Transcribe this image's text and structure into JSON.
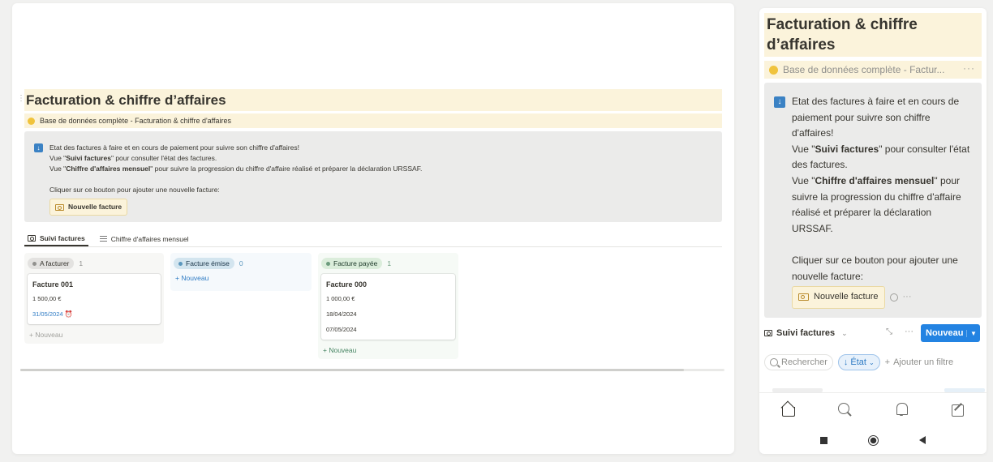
{
  "desktop": {
    "title": "Facturation & chiffre d’affaires",
    "db_link": "Base de données complète - Facturation & chiffre d'affaires",
    "callout": {
      "line1": "Etat des factures à faire et en cours de paiement pour suivre son chiffre d'affaires!",
      "line2_prefix": "Vue \"",
      "line2_bold": "Suivi factures",
      "line2_suffix": "\" pour consulter l'état des factures.",
      "line3_prefix": "Vue \"",
      "line3_bold": "Chiffre d'affaires mensuel",
      "line3_suffix": "\" pour suivre la progression du chiffre d'affaire réalisé et préparer la déclaration URSSAF.",
      "line4": "Cliquer sur ce bouton pour ajouter une nouvelle facture:",
      "button": "Nouvelle facture"
    },
    "tabs": [
      {
        "label": "Suivi factures",
        "icon": "board-icon"
      },
      {
        "label": "Chiffre d'affaires mensuel",
        "icon": "list-icon"
      }
    ],
    "columns": [
      {
        "status": "A facturer",
        "count": "1",
        "color": "#e3e2e0",
        "cards": [
          {
            "title": "Facture 001",
            "amount": "1 500,00 €",
            "date1": "31/05/2024"
          }
        ],
        "new": "Nouveau"
      },
      {
        "status": "Facture émise",
        "count": "0",
        "color": "#d3e5ef",
        "cards": [],
        "new": "Nouveau"
      },
      {
        "status": "Facture payée",
        "count": "1",
        "color": "#dbeddb",
        "cards": [
          {
            "title": "Facture 000",
            "amount": "1 000,00 €",
            "date1": "18/04/2024",
            "date2": "07/05/2024"
          }
        ],
        "new": "Nouveau"
      }
    ]
  },
  "mobile": {
    "title": "Facturation & chiffre d’affaires",
    "db_link": "Base de données complète - Factur...",
    "callout": {
      "line1": "Etat des factures à faire et en cours de paiement pour suivre son chiffre d'affaires!",
      "line2_prefix": "Vue \"",
      "line2_bold": "Suivi factures",
      "line2_suffix": "\" pour consulter l'état des factures.",
      "line3_prefix": "Vue \"",
      "line3_bold": "Chiffre d'affaires mensuel",
      "line3_suffix": "\" pour suivre la progression du chiffre d'affaire réalisé et préparer la déclaration URSSAF.",
      "line4": "Cliquer sur ce bouton pour ajouter une nouvelle facture:",
      "button": "Nouvelle facture"
    },
    "view_name": "Suivi factures",
    "new_button": "Nouveau",
    "search_label": "Rechercher",
    "filter_state": "État",
    "add_filter": "Ajouter un filtre"
  }
}
